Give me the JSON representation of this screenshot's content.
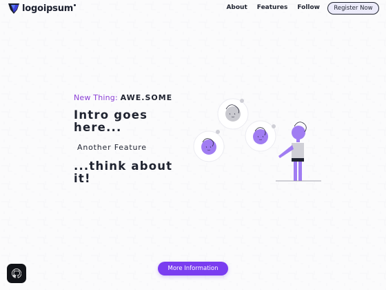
{
  "header": {
    "logo_text": "logoipsum",
    "nav": [
      {
        "label": "About"
      },
      {
        "label": "Features"
      },
      {
        "label": "Follow"
      }
    ],
    "register_label": "Register Now"
  },
  "hero": {
    "tagline_prefix": "New Thing:",
    "tagline_highlight": "AWE.SOME",
    "headline": "Intro goes here...",
    "feature": "Another Feature",
    "subheadline": "...think about it!"
  },
  "cta": {
    "label": "More Information"
  },
  "icons": {
    "fab": "github-icon",
    "logo": "shield-logo-icon"
  },
  "colors": {
    "accent": "#7a3df0",
    "tagline": "#8b3fd6",
    "text": "#1f2330",
    "avatar": "#a07cf2",
    "register_bg": "#ecebfa"
  }
}
